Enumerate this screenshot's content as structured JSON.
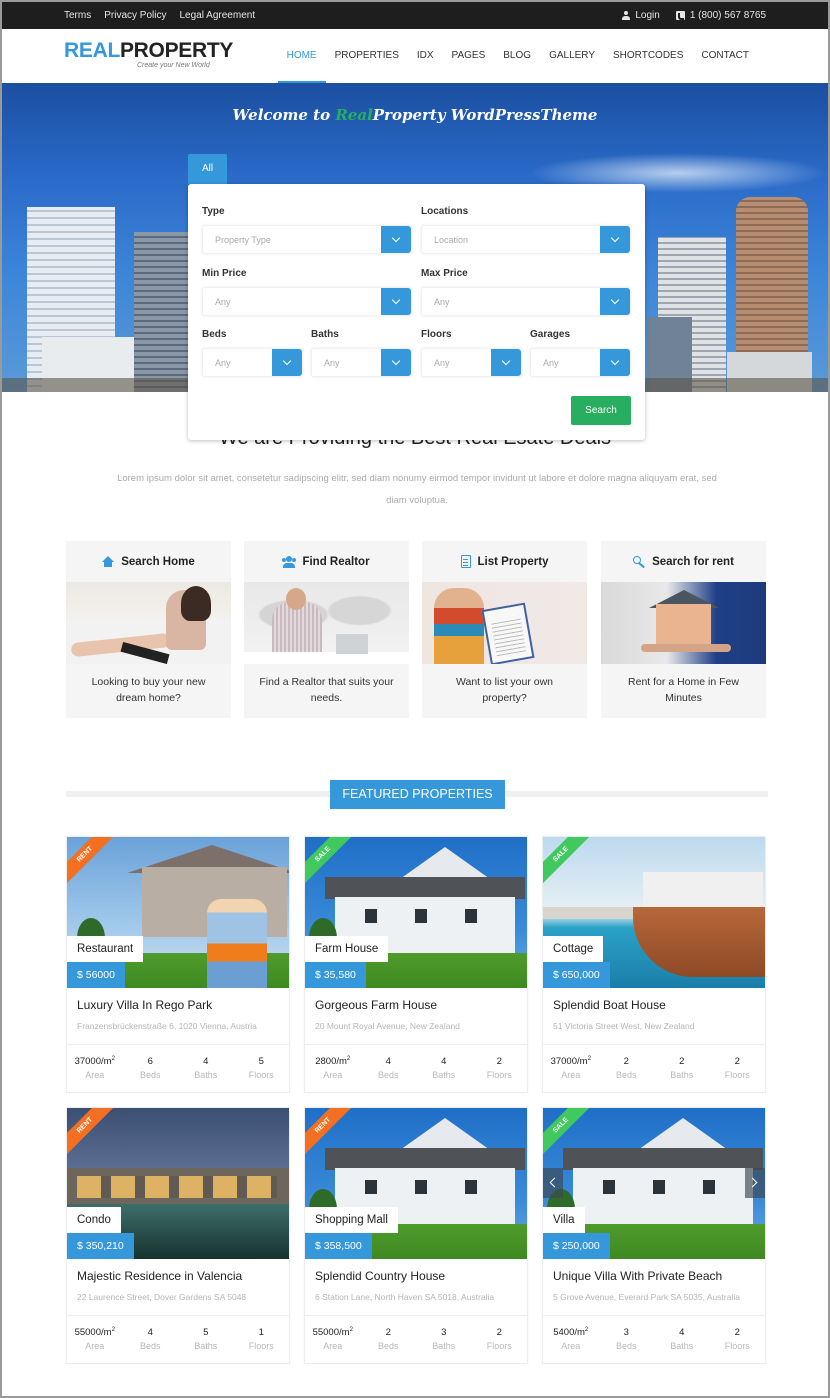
{
  "topbar": {
    "links": [
      "Terms",
      "Privacy Policy",
      "Legal Agreement"
    ],
    "login_label": "Login",
    "phone": "1 (800) 567 8765"
  },
  "header": {
    "logo_primary": "REAL",
    "logo_secondary": "PROPERTY",
    "tagline": "Create your New World",
    "nav": [
      {
        "label": "HOME",
        "active": true
      },
      {
        "label": "PROPERTIES",
        "active": false
      },
      {
        "label": "IDX",
        "active": false
      },
      {
        "label": "PAGES",
        "active": false
      },
      {
        "label": "BLOG",
        "active": false
      },
      {
        "label": "GALLERY",
        "active": false
      },
      {
        "label": "SHORTCODES",
        "active": false
      },
      {
        "label": "CONTACT",
        "active": false
      }
    ]
  },
  "hero": {
    "title_before": "Welcome to ",
    "title_accent": "Real",
    "title_after": "Property WordPressTheme"
  },
  "search": {
    "tab_label": "All",
    "fields": {
      "type": {
        "label": "Type",
        "value": "Property Type"
      },
      "location": {
        "label": "Locations",
        "value": "Location"
      },
      "min_price": {
        "label": "Min Price",
        "value": "Any"
      },
      "max_price": {
        "label": "Max Price",
        "value": "Any"
      },
      "beds": {
        "label": "Beds",
        "value": "Any"
      },
      "baths": {
        "label": "Baths",
        "value": "Any"
      },
      "floors": {
        "label": "Floors",
        "value": "Any"
      },
      "garages": {
        "label": "Garages",
        "value": "Any"
      }
    },
    "button_label": "Search"
  },
  "intro": {
    "title": "We are Providing the Best Real Esate Deals",
    "text": "Lorem ipsum dolor sit amet, consetetur sadipscing elitr, sed diam nonumy eirmod tempor invidunt ut labore et dolore magna aliquyam erat, sed diam voluptua."
  },
  "services": [
    {
      "icon": "home-icon",
      "title": "Search Home",
      "text": "Looking to buy your new dream home?"
    },
    {
      "icon": "users-icon",
      "title": "Find Realtor",
      "text": "Find a Realtor that suits your needs."
    },
    {
      "icon": "document-icon",
      "title": "List Property",
      "text": "Want to list your own property?"
    },
    {
      "icon": "key-icon",
      "title": "Search for rent",
      "text": "Rent for a Home in Few Minutes"
    }
  ],
  "featured": {
    "heading": "FEATURED PROPERTIES",
    "stat_labels": {
      "area": "Area",
      "beds": "Beds",
      "baths": "Baths",
      "floors": "Floors"
    },
    "area_unit": "/m",
    "area_exp": "2",
    "properties": [
      {
        "ribbon": "RENT",
        "type": "Restaurant",
        "price": "$ 56000",
        "title": "Luxury Villa In Rego Park",
        "address": "Franzensbrückenstraße 6, 1020 Vienna, Austria",
        "area": "37000",
        "beds": "6",
        "baths": "4",
        "floors": "5"
      },
      {
        "ribbon": "SALE",
        "type": "Farm House",
        "price": "$ 35,580",
        "title": "Gorgeous Farm House",
        "address": "20 Mount Royal Avenue, New Zealand",
        "area": "2800",
        "beds": "4",
        "baths": "4",
        "floors": "2"
      },
      {
        "ribbon": "SALE",
        "type": "Cottage",
        "price": "$ 650,000",
        "title": "Splendid Boat House",
        "address": "51 Victoria Street West, New Zealand",
        "area": "37000",
        "beds": "2",
        "baths": "2",
        "floors": "2"
      },
      {
        "ribbon": "RENT",
        "type": "Condo",
        "price": "$ 350,210",
        "title": "Majestic Residence in Valencia",
        "address": "22 Laurence Street, Dover Gardens SA 5048",
        "area": "55000",
        "beds": "4",
        "baths": "5",
        "floors": "1"
      },
      {
        "ribbon": "RENT",
        "type": "Shopping Mall",
        "price": "$ 358,500",
        "title": "Splendid Country House",
        "address": "6 Station Lane, North Haven SA 5018, Australia",
        "area": "55000",
        "beds": "2",
        "baths": "3",
        "floors": "2"
      },
      {
        "ribbon": "SALE",
        "type": "Villa",
        "price": "$ 250,000",
        "title": "Unique Villa With Private Beach",
        "address": "5 Grove Avenue, Everard Park SA 5035, Australia",
        "area": "5400",
        "beds": "3",
        "baths": "4",
        "floors": "2"
      }
    ]
  },
  "colors": {
    "accent": "#3498db",
    "success": "#27ae60",
    "rent_ribbon": "#f36f21",
    "sale_ribbon": "#41c85e",
    "topbar": "#1e1e1e"
  }
}
